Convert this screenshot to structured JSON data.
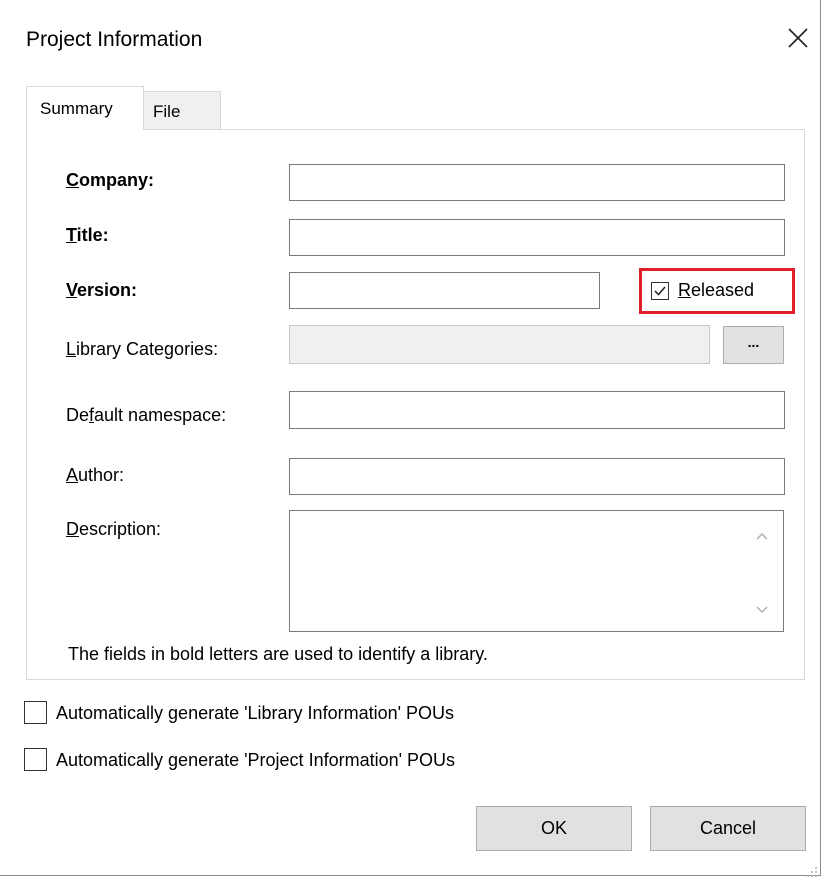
{
  "dialog": {
    "title": "Project Information",
    "close_icon": "close-icon"
  },
  "tabs": [
    {
      "label": "Summary",
      "selected": true
    },
    {
      "label": "File",
      "selected": false
    }
  ],
  "summary": {
    "company": {
      "label_u": "C",
      "label_rest": "ompany:",
      "value": ""
    },
    "title": {
      "label_u": "T",
      "label_rest": "itle:",
      "value": ""
    },
    "version": {
      "label_u": "V",
      "label_rest": "ersion:",
      "value": ""
    },
    "released": {
      "label_u": "R",
      "label_rest": "eleased",
      "checked": true
    },
    "library_categories": {
      "label_u": "L",
      "label_rest": "ibrary Categories:",
      "value": "",
      "button_label": "..."
    },
    "default_namespace": {
      "label_pre": "De",
      "label_u": "f",
      "label_rest": "ault namespace:",
      "value": ""
    },
    "author": {
      "label_u": "A",
      "label_rest": "uthor:",
      "value": ""
    },
    "description": {
      "label_u": "D",
      "label_rest": "escription:",
      "value": ""
    },
    "note": "The fields in bold letters are used to identify a library."
  },
  "options": [
    {
      "label": "Automatically generate 'Library Information' POUs",
      "checked": false
    },
    {
      "label": "Automatically generate 'Project Information' POUs",
      "checked": false
    }
  ],
  "buttons": {
    "ok": "OK",
    "cancel": "Cancel"
  },
  "colors": {
    "highlight_border": "#e0202a"
  }
}
